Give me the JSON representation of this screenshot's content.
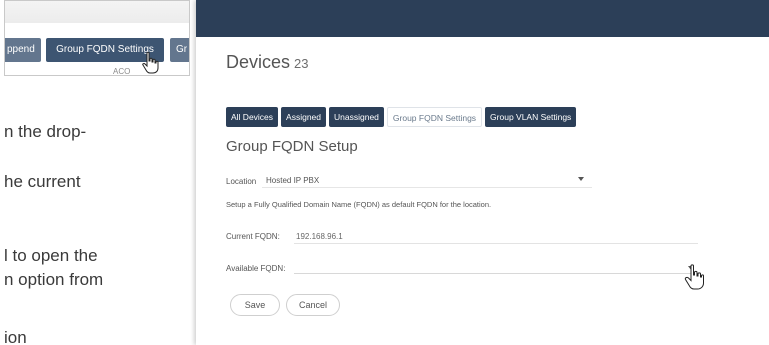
{
  "doc": {
    "frag1": "n the drop-",
    "frag2": "he current",
    "frag3": "l to open the",
    "frag4": "n option from",
    "frag5": "ion"
  },
  "thumb": {
    "left_btn": "ppend",
    "main_btn": "Group FQDN Settings",
    "right_btn": "Gr",
    "sub": "ACO"
  },
  "app": {
    "title": "Devices",
    "count": "23",
    "tabs": [
      {
        "label": "All Devices",
        "active": false
      },
      {
        "label": "Assigned",
        "active": false
      },
      {
        "label": "Unassigned",
        "active": false
      },
      {
        "label": "Group FQDN Settings",
        "active": true
      },
      {
        "label": "Group VLAN Settings",
        "active": false
      }
    ],
    "section_title": "Group FQDN Setup",
    "location_label": "Location",
    "location_value": "Hosted IP PBX",
    "description": "Setup a Fully Qualified Domain Name (FQDN) as default FQDN for the location.",
    "current_fqdn_label": "Current FQDN:",
    "current_fqdn_value": "192.168.96.1",
    "available_fqdn_label": "Available FQDN:",
    "save_label": "Save",
    "cancel_label": "Cancel"
  },
  "colors": {
    "header": "#2c3f58",
    "tab": "#2c3f58"
  }
}
